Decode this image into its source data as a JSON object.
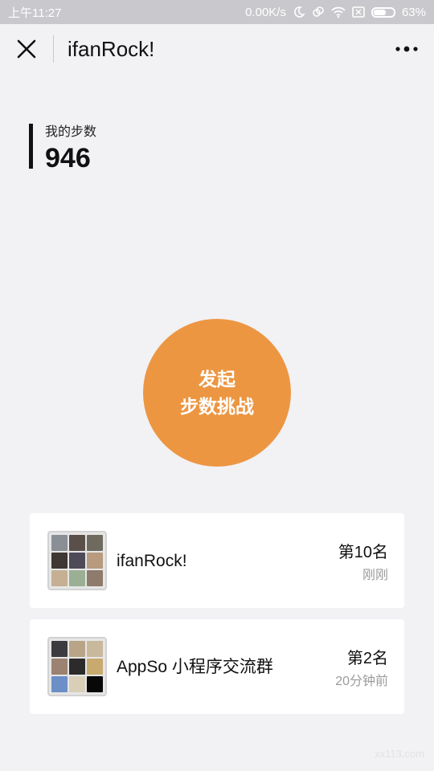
{
  "status_bar": {
    "time": "上午11:27",
    "network_speed": "0.00K/s",
    "battery_percent": "63%",
    "battery_level": 0.63,
    "icons": [
      "moon-icon",
      "link-icon",
      "wifi-icon",
      "sim-icon",
      "battery-icon"
    ]
  },
  "nav": {
    "title": "ifanRock!",
    "close_icon": "close-icon",
    "more_icon": "more-dots-icon"
  },
  "steps": {
    "label": "我的步数",
    "value": "946"
  },
  "challenge": {
    "line1": "发起",
    "line2": "步数挑战",
    "color": "#ec9642"
  },
  "groups": [
    {
      "name": "ifanRock!",
      "rank": "第10名",
      "time": "刚刚",
      "avatar_colors": [
        "#8a8f96",
        "#5b4f49",
        "#6f6a5e",
        "#3f3733",
        "#4f4a57",
        "#b89a7e",
        "#c6b093",
        "#9aaf94",
        "#8e7b6b"
      ]
    },
    {
      "name": "AppSo 小程序交流群",
      "rank": "第2名",
      "time": "20分钟前",
      "avatar_colors": [
        "#3c3a3e",
        "#b9a488",
        "#c9b99c",
        "#9b8271",
        "#2d2a2c",
        "#c8aa6e",
        "#6b8fc6",
        "#d9cfb9",
        "#080808"
      ]
    }
  ],
  "watermark": "xx113.com"
}
